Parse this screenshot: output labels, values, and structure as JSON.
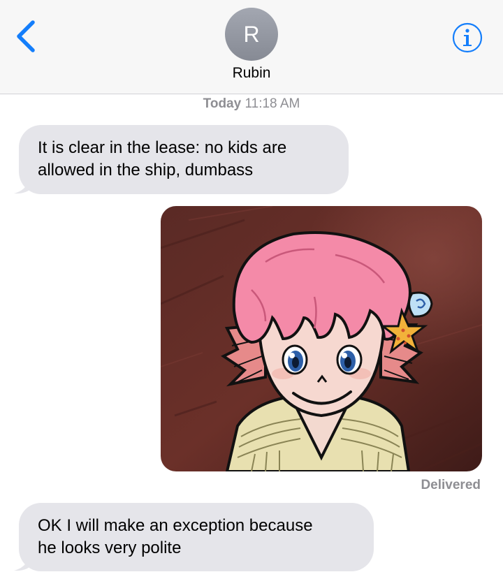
{
  "header": {
    "back_icon": "chevron-left-icon",
    "avatar_initial": "R",
    "contact_name": "Rubin",
    "info_icon": "info-icon",
    "accent_color": "#147efb"
  },
  "conversation": {
    "timestamp_day": "Today",
    "timestamp_time": "11:18 AM",
    "messages": [
      {
        "direction": "incoming",
        "lines": [
          "It is clear in the lease: no kids are",
          "allowed in the ship, dumbass"
        ]
      },
      {
        "direction": "outgoing",
        "type": "image",
        "image": "drawing of pink-haired cartoon child with fins and a starfish hair clip"
      },
      {
        "direction": "incoming",
        "lines": [
          "OK I will make an exception because",
          "he looks very polite"
        ]
      }
    ],
    "delivery_status": "Delivered",
    "incoming_bubble_color": "#e5e5ea"
  }
}
